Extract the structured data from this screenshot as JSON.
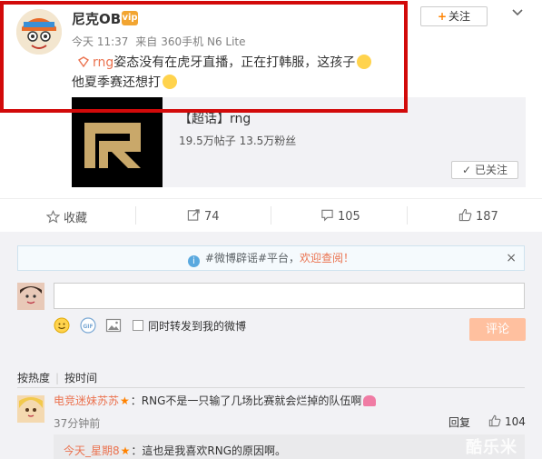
{
  "post": {
    "username": "尼克OB",
    "vip_badge": "vip",
    "follow_label": "关注",
    "follow_plus": "+",
    "time": "今天 11:37",
    "source_prefix": "来自",
    "source": "360手机 N6 Lite",
    "topic_link": "rng",
    "text_line1": "姿态没有在虎牙直播，正在打韩服，这孩子",
    "text_line2": "他夏季赛还想打"
  },
  "card": {
    "title": "【超话】rng",
    "posts": "19.5万帖子",
    "fans": "13.5万粉丝",
    "followed_label": "已关注",
    "followed_check": "✓"
  },
  "actions": {
    "favorite_label": "收藏",
    "repost_count": "74",
    "comment_count": "105",
    "like_count": "187"
  },
  "notice": {
    "text_prefix": "#微博辟谣#平台，",
    "text_highlight": "欢迎查阅！",
    "info_glyph": "i",
    "close_glyph": "×"
  },
  "composer": {
    "input_value": "",
    "repost_label": "同时转发到我的微博",
    "submit_label": "评论"
  },
  "sort": {
    "hot_label": "按热度",
    "separator": "|",
    "time_label": "按时间"
  },
  "comment": {
    "user": "电竞迷妹苏苏",
    "star": "★",
    "text": "：RNG不是一只输了几场比赛就会烂掉的队伍啊",
    "time": "37分钟前",
    "reply_label": "回复",
    "like_count": "104"
  },
  "sub_reply": {
    "user": "今天_星期8",
    "star": "★",
    "text": "：這也是我喜欢RNG的原因啊。"
  },
  "watermark": "酷乐米",
  "colors": {
    "accent_orange": "#eb7350",
    "highlight_red": "#d20a0a",
    "submit_disabled": "#ffc09f",
    "comment_bg": "#f2f2f5"
  }
}
